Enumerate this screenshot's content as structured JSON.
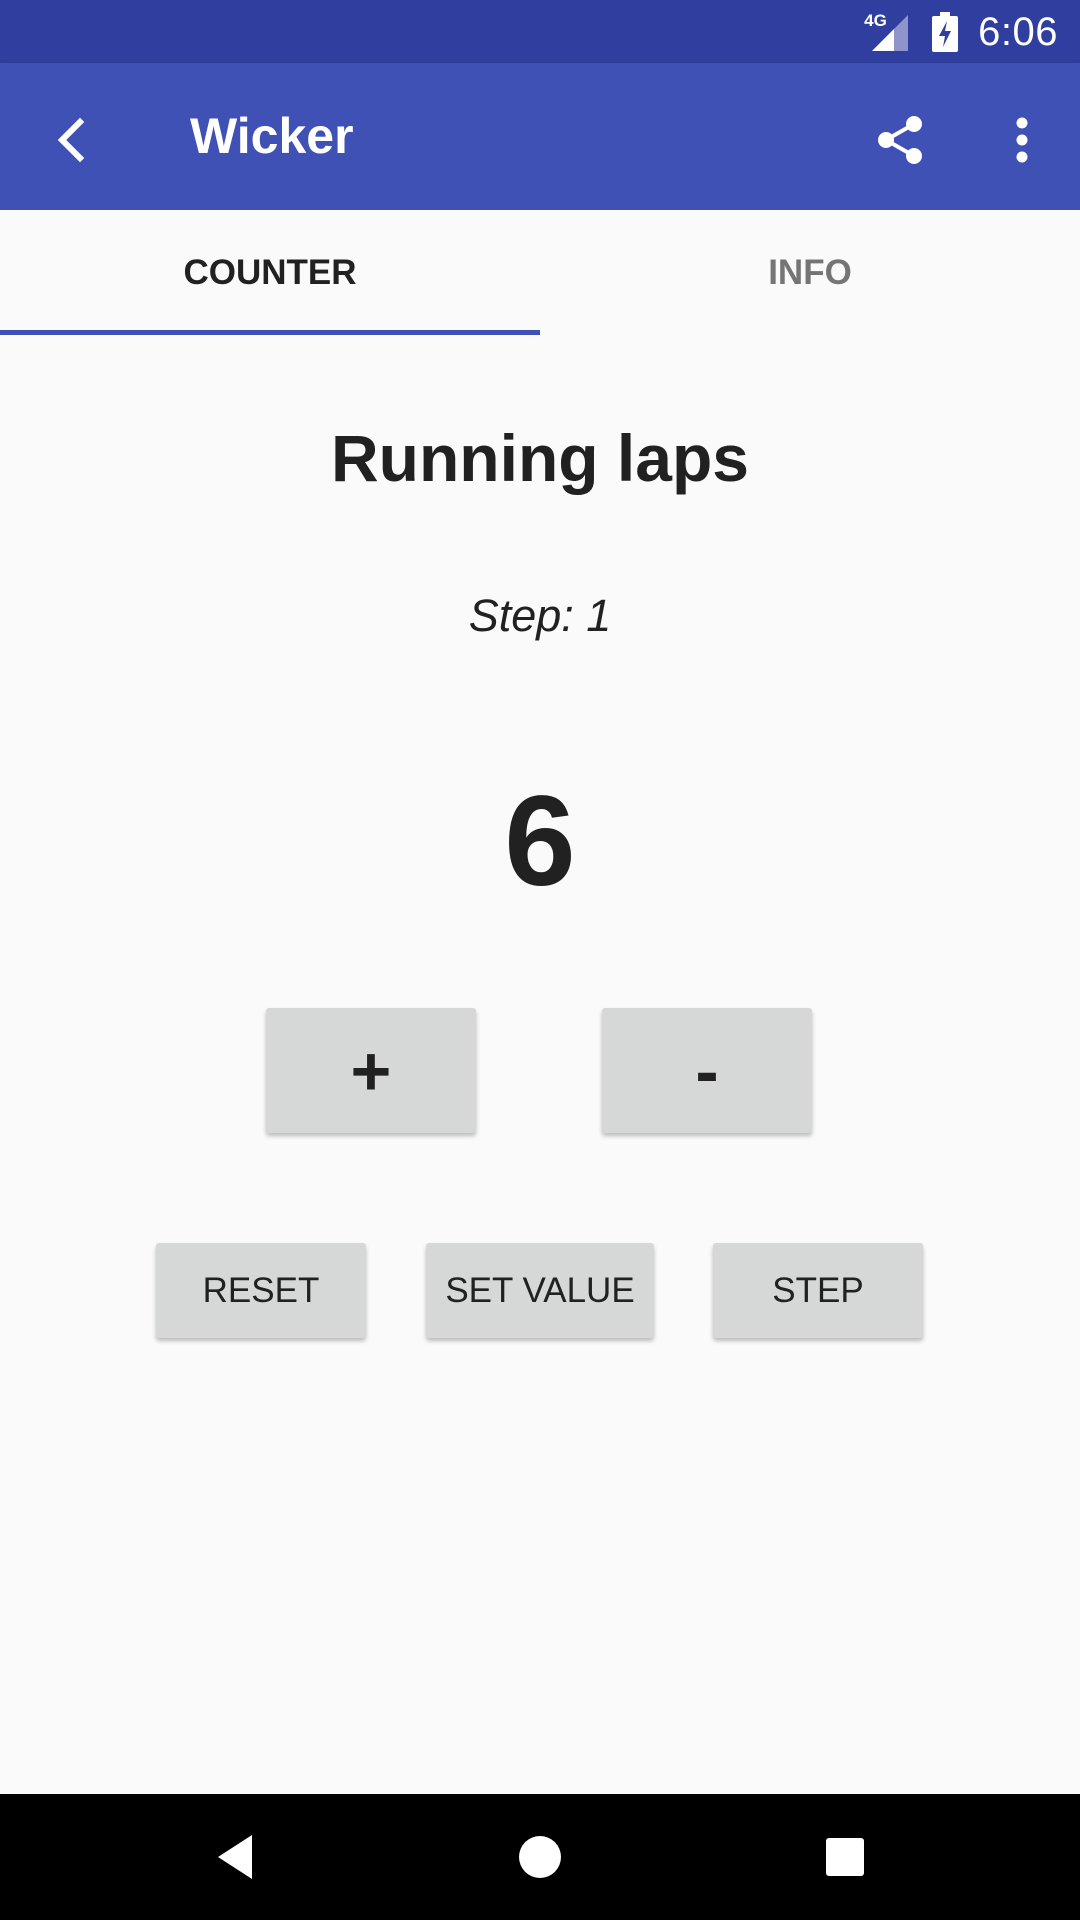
{
  "status_bar": {
    "network_label": "4G",
    "time": "6:06"
  },
  "app_bar": {
    "title": "Wicker"
  },
  "tabs": [
    {
      "label": "COUNTER",
      "selected": true
    },
    {
      "label": "INFO",
      "selected": false
    }
  ],
  "counter": {
    "name": "Running laps",
    "step_text": "Step: 1",
    "value": "6"
  },
  "buttons": {
    "increment": "+",
    "decrement": "-",
    "reset": "RESET",
    "set_value": "SET VALUE",
    "step": "STEP"
  },
  "colors": {
    "status_bar": "#303f9f",
    "app_bar": "#3f51b5",
    "accent": "#3f51b5",
    "button": "#d6d7d7"
  },
  "icons": {
    "back": "arrow-back-icon",
    "share": "share-icon",
    "more": "more-vert-icon",
    "signal": "signal-icon",
    "battery": "battery-charging-icon"
  }
}
